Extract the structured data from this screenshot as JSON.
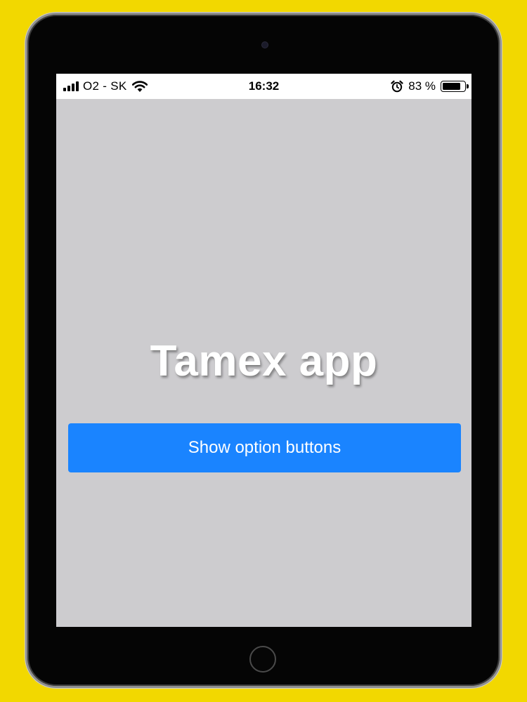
{
  "status_bar": {
    "carrier": "O2 - SK",
    "time": "16:32",
    "battery_percent_text": "83 %",
    "battery_level": 0.83,
    "signal_bars": 4,
    "icons": [
      "signal-icon",
      "wifi-icon",
      "alarm-icon",
      "battery-icon"
    ]
  },
  "app": {
    "title": "Tamex app",
    "primary_button_label": "Show option buttons"
  },
  "colors": {
    "frame_background": "#f2d800",
    "device_body": "#050505",
    "screen_background": "#cdcccf",
    "button_background": "#1a84ff",
    "button_text": "#ffffff",
    "title_text": "#ffffff"
  }
}
